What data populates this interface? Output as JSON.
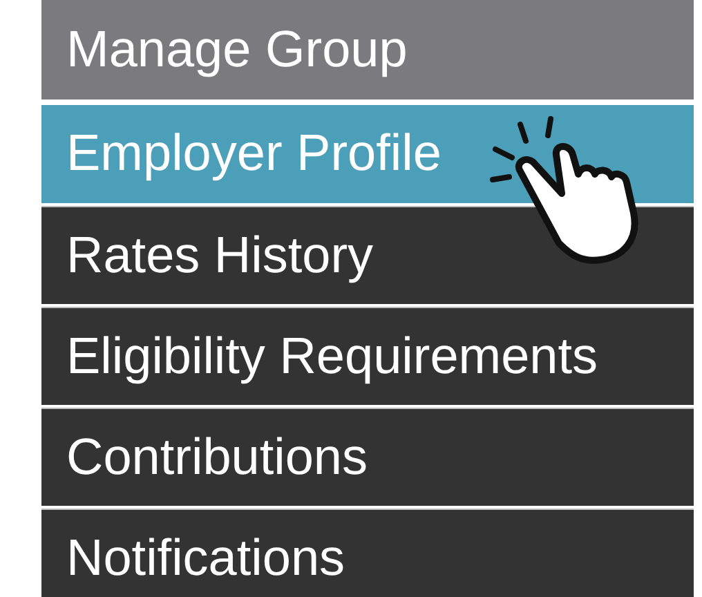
{
  "menu": {
    "title": "Manage Group",
    "items": [
      {
        "label": "Employer Profile",
        "selected": true
      },
      {
        "label": "Rates History",
        "selected": false
      },
      {
        "label": "Eligibility Requirements",
        "selected": false
      },
      {
        "label": "Contributions",
        "selected": false
      },
      {
        "label": "Notifications",
        "selected": false
      }
    ]
  }
}
